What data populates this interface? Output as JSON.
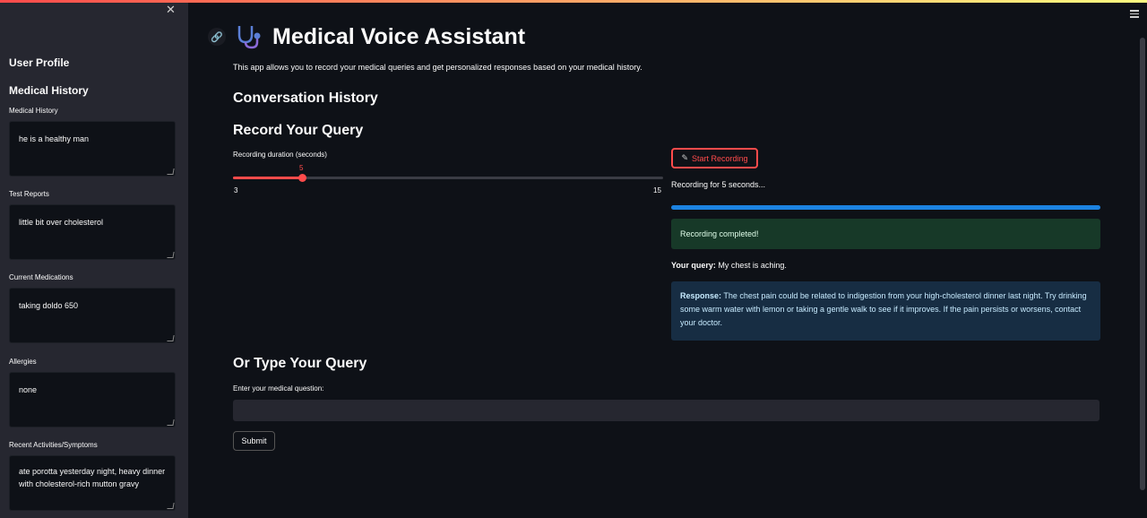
{
  "sidebar": {
    "close_icon": "✕",
    "heading": "User Profile",
    "subheading": "Medical History",
    "fields": [
      {
        "label": "Medical History",
        "value": "he is a healthy man"
      },
      {
        "label": "Test Reports",
        "value": "little bit over cholesterol"
      },
      {
        "label": "Current Medications",
        "value": "taking doldo 650"
      },
      {
        "label": "Allergies",
        "value": "none"
      },
      {
        "label": "Recent Activities/Symptoms",
        "value": "ate porotta yesterday night, heavy dinner with cholesterol-rich mutton gravy"
      }
    ]
  },
  "main": {
    "title": "Medical Voice Assistant",
    "title_icon": "stethoscope-icon",
    "intro": "This app allows you to record your medical queries and get personalized responses based on your medical history.",
    "conversation_heading": "Conversation History",
    "record_heading": "Record Your Query",
    "slider": {
      "label": "Recording duration (seconds)",
      "value": "5",
      "min": "3",
      "max": "15",
      "fraction": 0.1667
    },
    "record_button": "Start Recording",
    "record_status": "Recording for 5 seconds...",
    "progress": 1.0,
    "success_text": "Recording completed!",
    "query_label": "Your query:",
    "query_text": "My chest is aching.",
    "response_label": "Response:",
    "response_text": "The chest pain could be related to indigestion from your high-cholesterol dinner last night. Try drinking some warm water with lemon or taking a gentle walk to see if it improves. If the pain persists or worsens, contact your doctor.",
    "type_heading": "Or Type Your Query",
    "type_label": "Enter your medical question:",
    "type_value": "",
    "submit_label": "Submit"
  },
  "colors": {
    "accent": "#ff4b4b",
    "progress": "#1c83e1",
    "success_bg": "#173928",
    "info_bg": "#172d43"
  }
}
